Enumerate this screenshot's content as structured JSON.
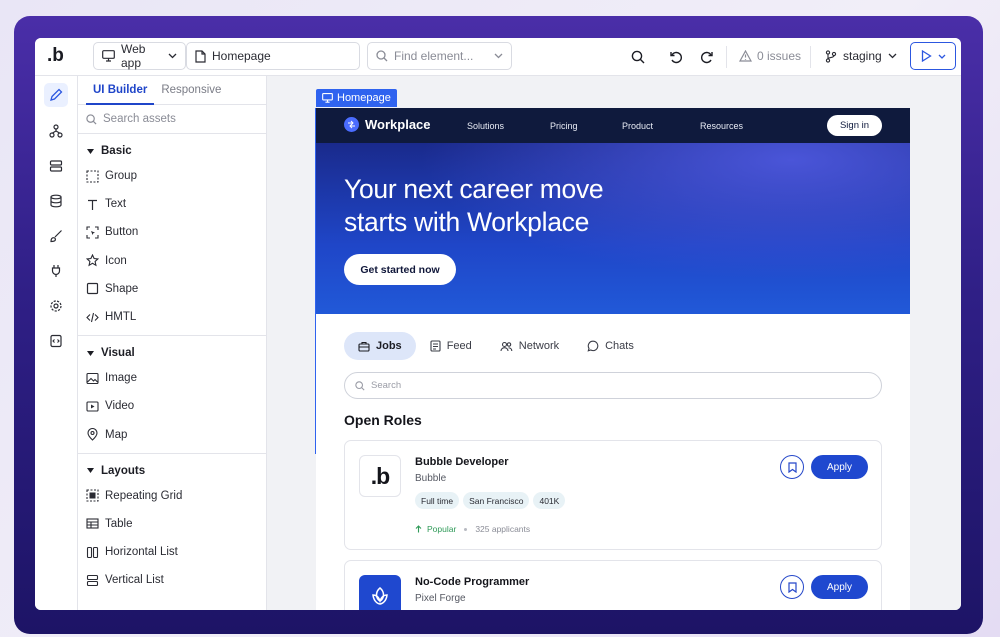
{
  "topbar": {
    "logo_text": ".b",
    "app_select": "Web app",
    "page_select": "Homepage",
    "find_placeholder": "Find element...",
    "issues": "0 issues",
    "branch": "staging"
  },
  "rail": {
    "icons": [
      "pencil-icon",
      "hierarchy-icon",
      "database-rows-icon",
      "database-icon",
      "brush-icon",
      "plug-icon",
      "settings-icon",
      "code-file-icon"
    ],
    "active": "pencil-icon"
  },
  "panel": {
    "tabs": [
      "UI Builder",
      "Responsive"
    ],
    "active_tab": "UI Builder",
    "search_placeholder": "Search assets",
    "sections": [
      {
        "title": "Basic",
        "items": [
          "Group",
          "Text",
          "Button",
          "Icon",
          "Shape",
          "HMTL"
        ]
      },
      {
        "title": "Visual",
        "items": [
          "Image",
          "Video",
          "Map"
        ]
      },
      {
        "title": "Layouts",
        "items": [
          "Repeating Grid",
          "Table",
          "Horizontal List",
          "Vertical List"
        ]
      }
    ]
  },
  "canvas": {
    "page_label": "Homepage",
    "nav": {
      "brand": "Workplace",
      "links": [
        "Solutions",
        "Pricing",
        "Product",
        "Resources"
      ],
      "signin": "Sign in"
    },
    "hero": {
      "heading": "Your next career move starts with Workplace",
      "cta": "Get started now"
    },
    "tabs": [
      "Jobs",
      "Feed",
      "Network",
      "Chats"
    ],
    "active_tab": "Jobs",
    "search_placeholder": "Search",
    "roles_title": "Open Roles",
    "jobs": [
      {
        "title": "Bubble Developer",
        "company": "Bubble",
        "tags": [
          "Full time",
          "San Francisco",
          "401K"
        ],
        "popular": "Popular",
        "applicants": "325 applicants",
        "apply": "Apply"
      },
      {
        "title": "No-Code Programmer",
        "company": "Pixel Forge",
        "apply": "Apply"
      }
    ]
  },
  "colors": {
    "accent": "#2c57e0",
    "hero_dark": "#1a2a8c",
    "nav": "#0f1a3d",
    "apply": "#1f48cf"
  }
}
